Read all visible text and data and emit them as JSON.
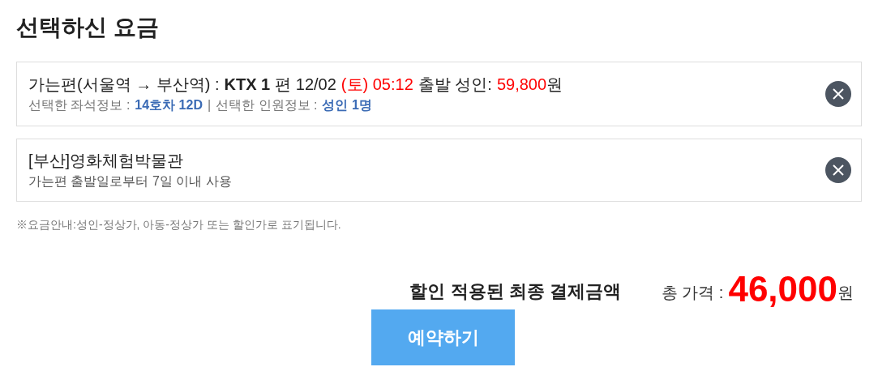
{
  "title": "선택하신 요금",
  "items": [
    {
      "kind": "train",
      "line1": [
        {
          "kind": "plain",
          "text": "가는편(서울역 → 부산역) :"
        },
        {
          "kind": "bold",
          "text": "KTX 1"
        },
        {
          "kind": "plain",
          "text": "편 12/02"
        },
        {
          "kind": "red",
          "text": "(토) 05:12"
        },
        {
          "kind": "plain",
          "text": "출발 성인:"
        },
        {
          "kind": "red",
          "text": "59,800"
        },
        {
          "kind": "tight",
          "text": "원"
        }
      ],
      "line2": [
        {
          "kind": "label",
          "text": "선택한 좌석정보 :"
        },
        {
          "kind": "value",
          "text": "14호차 12D"
        },
        {
          "kind": "label",
          "text": "|"
        },
        {
          "kind": "label",
          "text": "선택한 인원정보 :"
        },
        {
          "kind": "value",
          "text": "성인 1명"
        }
      ]
    },
    {
      "kind": "ticket",
      "line1": [
        {
          "kind": "plain",
          "text": "[부산]영화체험박물관"
        }
      ],
      "line2": [
        {
          "kind": "plain",
          "text": "가는편 출발일로부터 7일 이내 사용"
        }
      ]
    }
  ],
  "notice": "※요금안내:성인-정상가, 아동-정상가 또는 할인가로 표기됩니다.",
  "summary": {
    "heading": "할인 적용된 최종 결제금액",
    "total_label": "총 가격 :",
    "total": "46,000",
    "currency": "원"
  },
  "button": "예약하기"
}
